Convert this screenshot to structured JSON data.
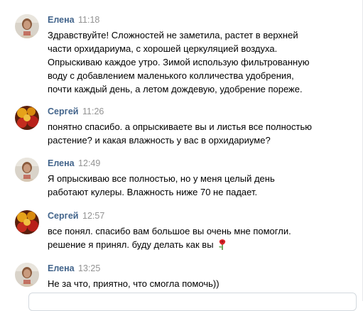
{
  "messages": [
    {
      "author": "Елена",
      "time": "11:18",
      "lines": [
        "Здравствуйте! Сложностей не заметила, растет в верхней",
        "части орхидариума, с хорошей церкуляцией воздуха.",
        "Опрыскиваю каждое утро. Зимой использую фильтрованную",
        "воду с добавлением маленького колличества удобрения,",
        "почти каждый день, а летом дождевую, удобрение пореже."
      ]
    },
    {
      "author": "Сергей",
      "time": "11:26",
      "lines": [
        "понятно спасибо. а опрыскиваете вы и листья все полностью",
        "растение? и какая влажность у вас в орхидариуме?"
      ]
    },
    {
      "author": "Елена",
      "time": "12:49",
      "lines": [
        "Я опрыскиваю все полностью, но у меня целый день",
        "работают кулеры. Влажность ниже 70 не падает."
      ]
    },
    {
      "author": "Сергей",
      "time": "12:57",
      "lines": [
        "все понял. спасибо вам большое вы очень мне помогли.",
        "решение я принял. буду делать как вы"
      ],
      "emoji": "rose-emoji-icon"
    },
    {
      "author": "Елена",
      "time": "13:25",
      "lines": [
        "Не за что, приятно, что смогла помочь))"
      ]
    }
  ],
  "colors": {
    "author": "#42648b",
    "time": "#939393",
    "text": "#000000"
  }
}
